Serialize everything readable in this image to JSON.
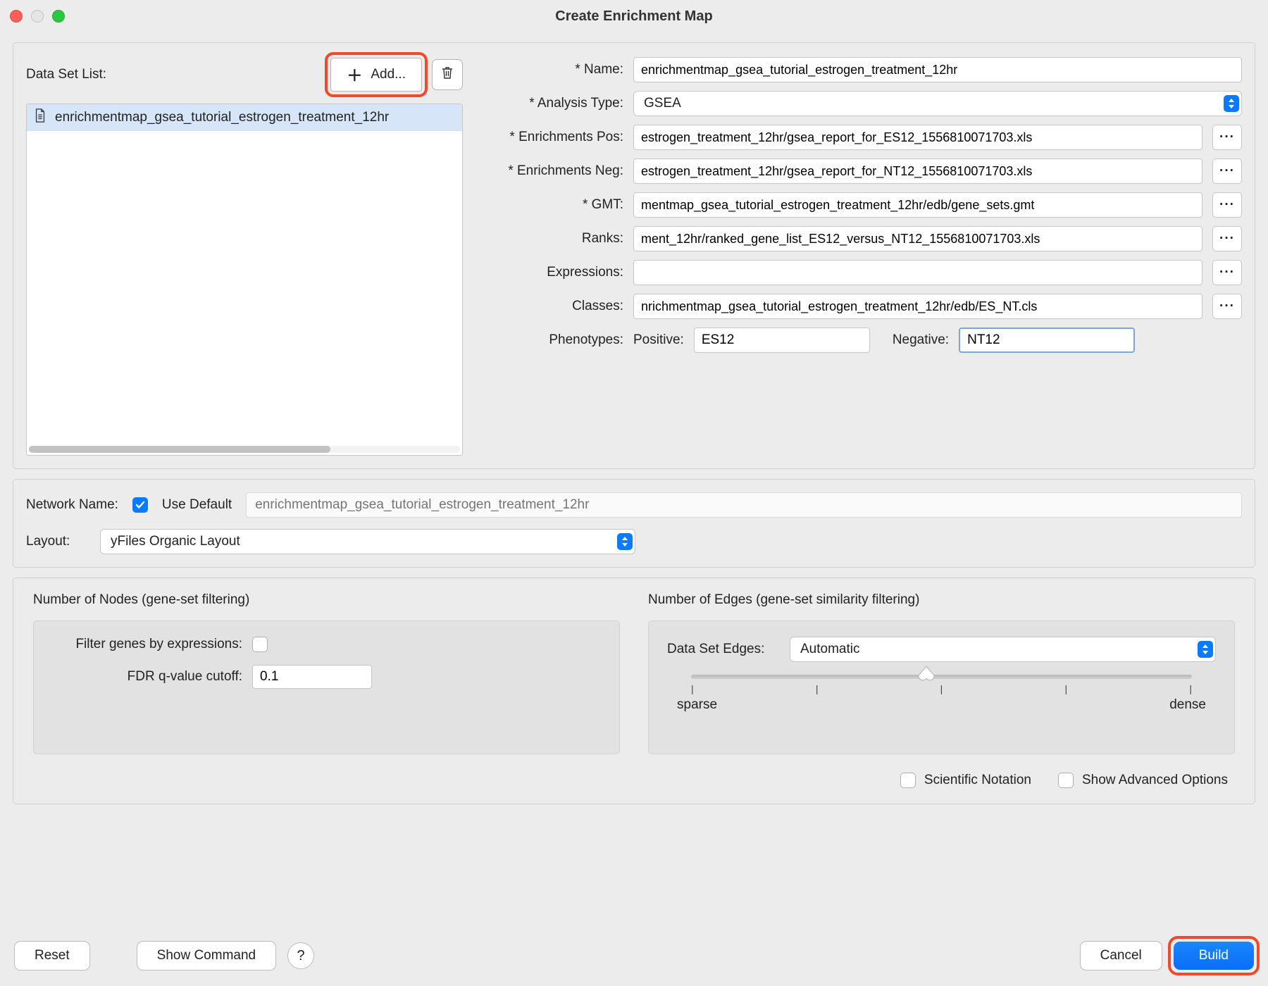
{
  "window": {
    "title": "Create Enrichment Map"
  },
  "dataset": {
    "list_label": "Data Set List:",
    "add_label": "Add...",
    "items": [
      {
        "name": "enrichmentmap_gsea_tutorial_estrogen_treatment_12hr"
      }
    ]
  },
  "form": {
    "name": {
      "label": "* Name:",
      "value": "enrichmentmap_gsea_tutorial_estrogen_treatment_12hr"
    },
    "analysis_type": {
      "label": "* Analysis Type:",
      "value": "GSEA"
    },
    "enrich_pos": {
      "label": "* Enrichments Pos:",
      "value": "estrogen_treatment_12hr/gsea_report_for_ES12_1556810071703.xls"
    },
    "enrich_neg": {
      "label": "* Enrichments Neg:",
      "value": "estrogen_treatment_12hr/gsea_report_for_NT12_1556810071703.xls"
    },
    "gmt": {
      "label": "* GMT:",
      "value": "mentmap_gsea_tutorial_estrogen_treatment_12hr/edb/gene_sets.gmt"
    },
    "ranks": {
      "label": "Ranks:",
      "value": "ment_12hr/ranked_gene_list_ES12_versus_NT12_1556810071703.xls"
    },
    "expressions": {
      "label": "Expressions:",
      "value": ""
    },
    "classes": {
      "label": "Classes:",
      "value": "nrichmentmap_gsea_tutorial_estrogen_treatment_12hr/edb/ES_NT.cls"
    },
    "phenotypes": {
      "label": "Phenotypes:",
      "pos_label": "Positive:",
      "pos_value": "ES12",
      "neg_label": "Negative:",
      "neg_value": "NT12"
    },
    "browse_label": "···"
  },
  "network": {
    "name_label": "Network Name:",
    "use_default_label": "Use Default",
    "use_default": true,
    "name_placeholder": "enrichmentmap_gsea_tutorial_estrogen_treatment_12hr",
    "layout_label": "Layout:",
    "layout_value": "yFiles Organic Layout"
  },
  "filter": {
    "nodes_title": "Number of Nodes (gene-set filtering)",
    "filter_genes_label": "Filter genes by expressions:",
    "filter_genes": false,
    "fdr_label": "FDR q-value cutoff:",
    "fdr_value": "0.1",
    "edges_title": "Number of Edges (gene-set similarity filtering)",
    "edges_label": "Data Set Edges:",
    "edges_value": "Automatic",
    "slider": {
      "left": "sparse",
      "right": "dense",
      "position_pct": 47
    },
    "sci_notation_label": "Scientific Notation",
    "sci_notation": false,
    "advanced_label": "Show Advanced Options",
    "advanced": false
  },
  "buttons": {
    "reset": "Reset",
    "show_command": "Show Command",
    "help": "?",
    "cancel": "Cancel",
    "build": "Build"
  }
}
